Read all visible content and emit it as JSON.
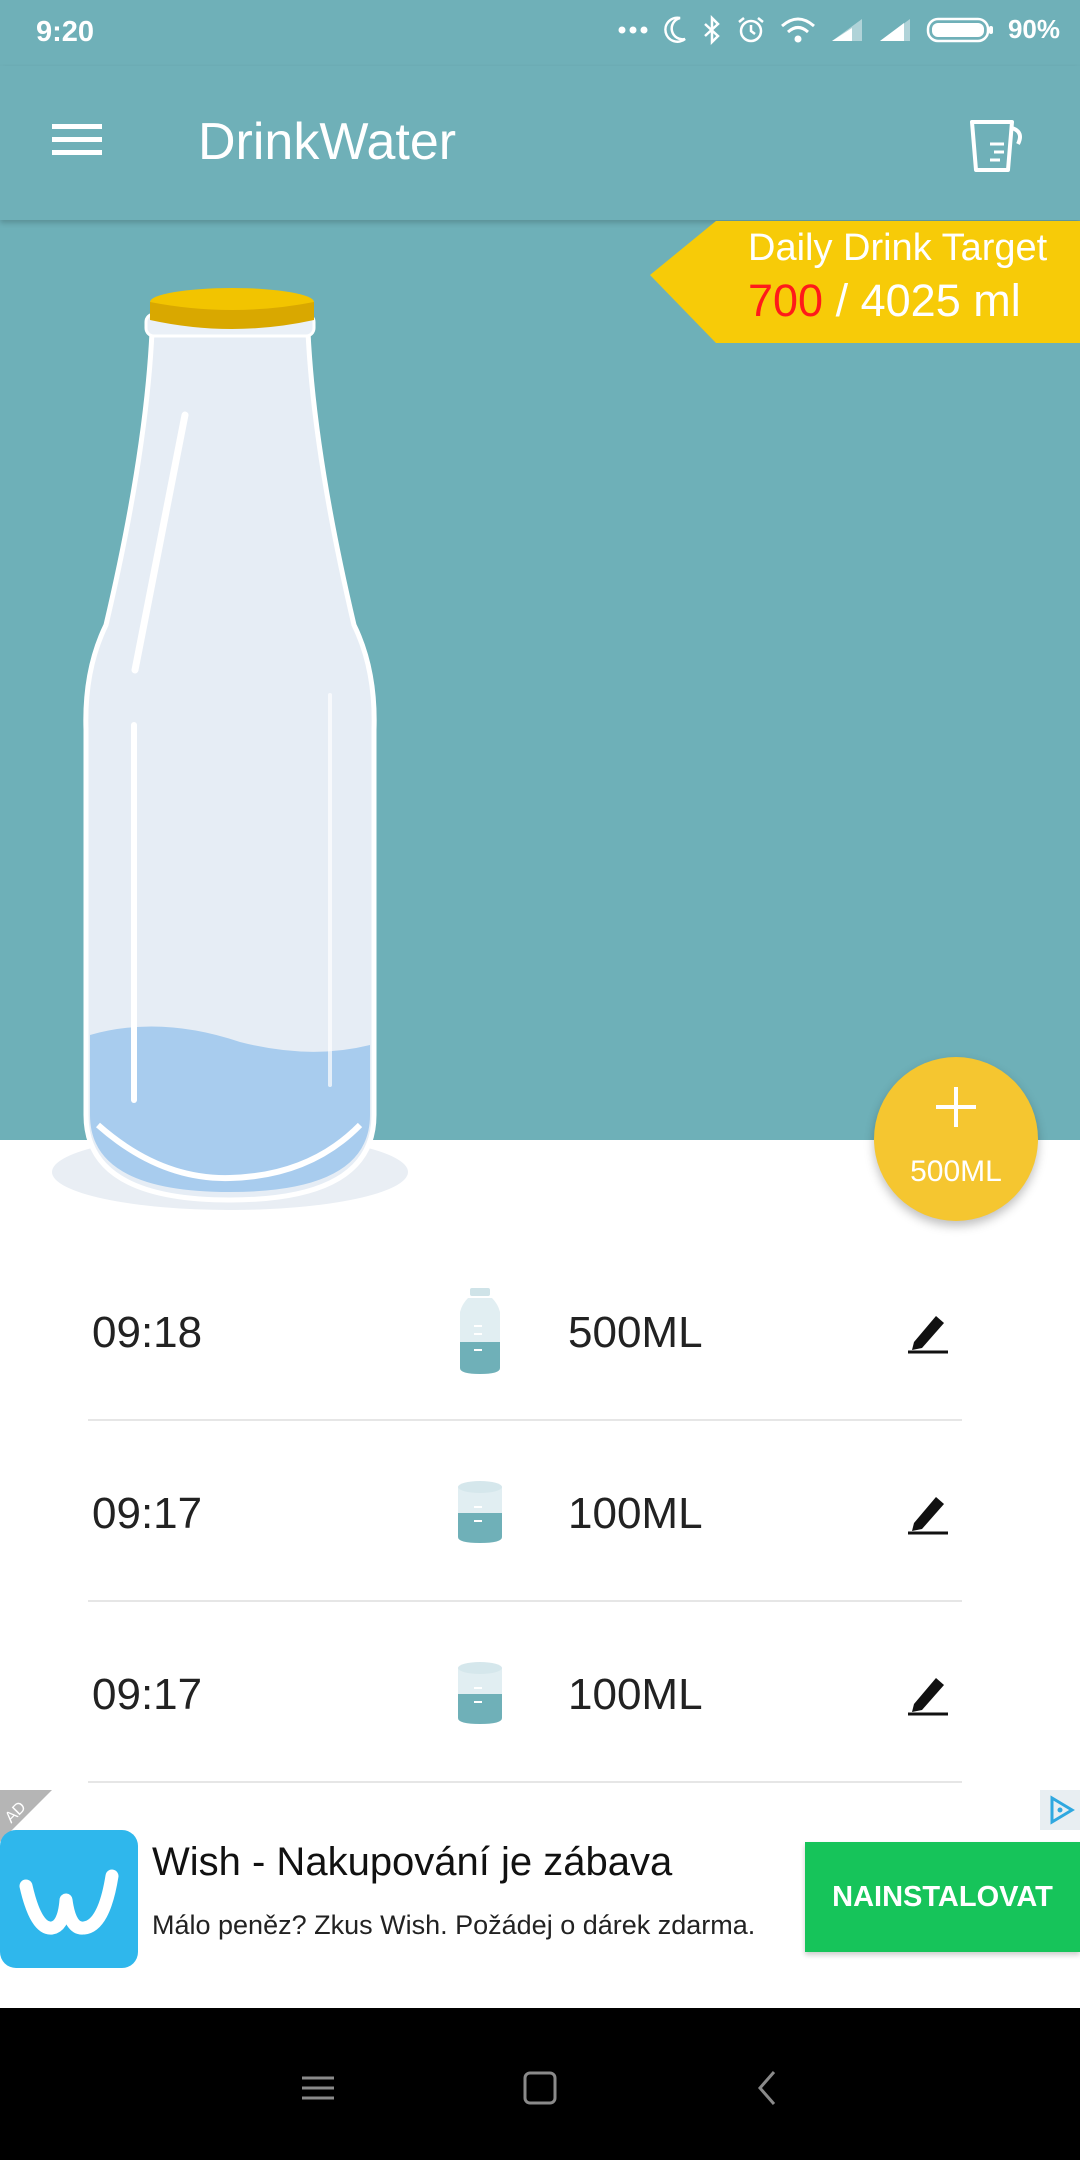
{
  "status_bar": {
    "time": "9:20",
    "battery": "90%",
    "icons": [
      "more-icon",
      "moon-icon",
      "bluetooth-icon",
      "alarm-icon",
      "wifi-icon",
      "signal-icon",
      "signal-icon",
      "battery-icon"
    ]
  },
  "app_bar": {
    "title": "DrinkWater",
    "menu_icon": "menu-icon",
    "history_icon": "drink-history-icon"
  },
  "target": {
    "label": "Daily Drink Target",
    "current": "700",
    "separator": " / ",
    "goal_text": "4025 ml",
    "progress": 0.174
  },
  "fab": {
    "label": "500ML",
    "icon": "plus-icon"
  },
  "log": [
    {
      "time": "09:18",
      "amount": "500ML",
      "vessel": "bottle-icon"
    },
    {
      "time": "09:17",
      "amount": "100ML",
      "vessel": "cup-icon"
    },
    {
      "time": "09:17",
      "amount": "100ML",
      "vessel": "cup-icon"
    }
  ],
  "ad": {
    "badge": "AD",
    "title": "Wish - Nakupování je zábava",
    "description": "Málo peněz? Zkus Wish. Požádej o dárek zdarma.",
    "button": "NAINSTALOVAT"
  },
  "colors": {
    "primary": "#6fb0b8",
    "accent": "#f5c630",
    "badge": "#f7cb08",
    "target_current": "#ff1a1a",
    "install": "#16c45a"
  }
}
